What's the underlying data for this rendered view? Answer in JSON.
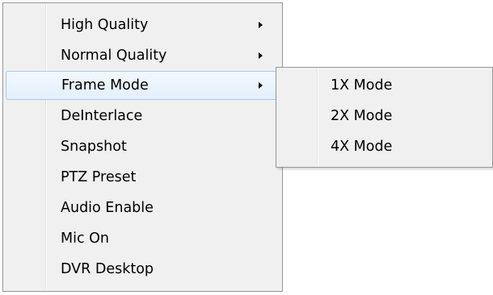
{
  "context_menu": {
    "items": [
      {
        "label": "High Quality",
        "has_submenu": true
      },
      {
        "label": "Normal Quality",
        "has_submenu": true
      },
      {
        "label": "Frame Mode",
        "has_submenu": true,
        "highlighted": true
      },
      {
        "label": "DeInterlace",
        "has_submenu": false
      },
      {
        "label": "Snapshot",
        "has_submenu": false
      },
      {
        "label": "PTZ Preset",
        "has_submenu": false
      },
      {
        "label": "Audio Enable",
        "has_submenu": false
      },
      {
        "label": "Mic On",
        "has_submenu": false
      },
      {
        "label": "DVR Desktop",
        "has_submenu": false
      }
    ]
  },
  "frame_mode_submenu": {
    "items": [
      {
        "label": "1X Mode"
      },
      {
        "label": "2X Mode"
      },
      {
        "label": "4X Mode"
      }
    ]
  },
  "colors": {
    "menu_background": "#f0f0f0",
    "menu_border": "#979797",
    "highlight_border": "#a9c8ea",
    "highlight_fill": "#e8f1fb"
  },
  "icons": {
    "submenu_arrow": "submenu-arrow-icon"
  }
}
